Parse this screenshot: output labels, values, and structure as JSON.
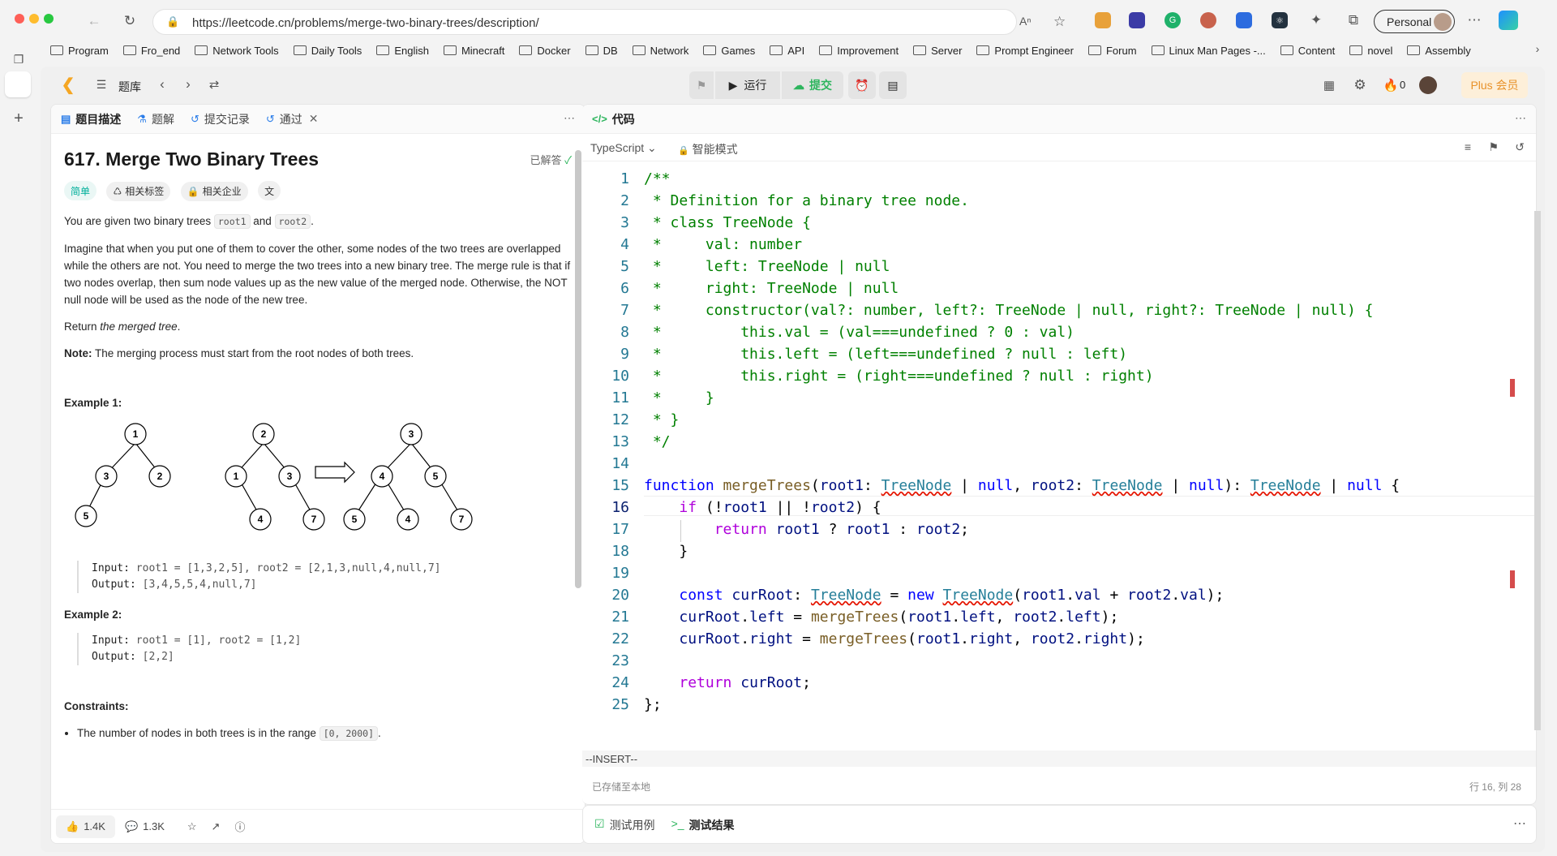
{
  "browser": {
    "url": "https://leetcode.cn/problems/merge-two-binary-trees/description/",
    "profile": "Personal",
    "bookmarks": [
      "Program",
      "Fro_end",
      "Network Tools",
      "Daily Tools",
      "English",
      "Minecraft",
      "Docker",
      "DB",
      "Network",
      "Games",
      "API",
      "Improvement",
      "Server",
      "Prompt Engineer",
      "Forum",
      "Linux Man Pages -...",
      "Content",
      "novel",
      "Assembly"
    ]
  },
  "topbar": {
    "library": "题库",
    "run": "运行",
    "submit": "提交",
    "fire_count": "0",
    "plus": "Plus 会员"
  },
  "left_tabs": [
    "题目描述",
    "题解",
    "提交记录",
    "通过"
  ],
  "problem": {
    "title": "617. Merge Two Binary Trees",
    "solved": "已解答",
    "difficulty": "简单",
    "tag_related": "相关标签",
    "tag_company": "相关企业",
    "p1_a": "You are given two binary trees ",
    "p1_code1": "root1",
    "p1_b": " and ",
    "p1_code2": "root2",
    "p1_c": ".",
    "p2": "Imagine that when you put one of them to cover the other, some nodes of the two trees are overlapped while the others are not. You need to merge the two trees into a new binary tree. The merge rule is that if two nodes overlap, then sum node values up as the new value of the merged node. Otherwise, the NOT null node will be used as the node of the new tree.",
    "p3_a": "Return ",
    "p3_em": "the merged tree",
    "p3_b": ".",
    "note_label": "Note:",
    "note_text": " The merging process must start from the root nodes of both trees.",
    "ex1_title": "Example 1:",
    "ex1_input_label": "Input:",
    "ex1_input": " root1 = [1,3,2,5], root2 = [2,1,3,null,4,null,7]",
    "ex1_output_label": "Output:",
    "ex1_output": " [3,4,5,5,4,null,7]",
    "ex2_title": "Example 2:",
    "ex2_input_label": "Input:",
    "ex2_input": " root1 = [1], root2 = [1,2]",
    "ex2_output_label": "Output:",
    "ex2_output": " [2,2]",
    "constraints_title": "Constraints:",
    "c1_a": "The number of nodes in both trees is in the range ",
    "c1_code": "[0, 2000]",
    "c1_b": ".",
    "trees": {
      "tree1": [
        "1",
        "3",
        "2",
        "5"
      ],
      "tree2": [
        "2",
        "1",
        "3",
        "4",
        "7"
      ],
      "merged": [
        "3",
        "4",
        "5",
        "5",
        "4",
        "7"
      ]
    }
  },
  "footer_left": {
    "likes": "1.4K",
    "comments": "1.3K"
  },
  "code_panel": {
    "title": "代码",
    "language": "TypeScript",
    "mode": "智能模式",
    "status_mode": "--INSERT--",
    "saved": "已存储至本地",
    "cursor": "行 16, 列 28"
  },
  "code_lines": [
    "1",
    "2",
    "3",
    "4",
    "5",
    "6",
    "7",
    "8",
    "9",
    "10",
    "11",
    "12",
    "13",
    "14",
    "15",
    "16",
    "17",
    "18",
    "19",
    "20",
    "21",
    "22",
    "23",
    "24",
    "25"
  ],
  "code": {
    "l1": "/**",
    "l2": " * Definition for a binary tree node.",
    "l3": " * class TreeNode {",
    "l4": " *     val: number",
    "l5": " *     left: TreeNode | null",
    "l6": " *     right: TreeNode | null",
    "l7": " *     constructor(val?: number, left?: TreeNode | null, right?: TreeNode | null) {",
    "l8": " *         this.val = (val===undefined ? 0 : val)",
    "l9": " *         this.left = (left===undefined ? null : left)",
    "l10": " *         this.right = (right===undefined ? null : right)",
    "l11": " *     }",
    "l12": " * }",
    "l13": " */"
  },
  "bottom_tabs": {
    "testcase": "测试用例",
    "result": "测试结果"
  }
}
